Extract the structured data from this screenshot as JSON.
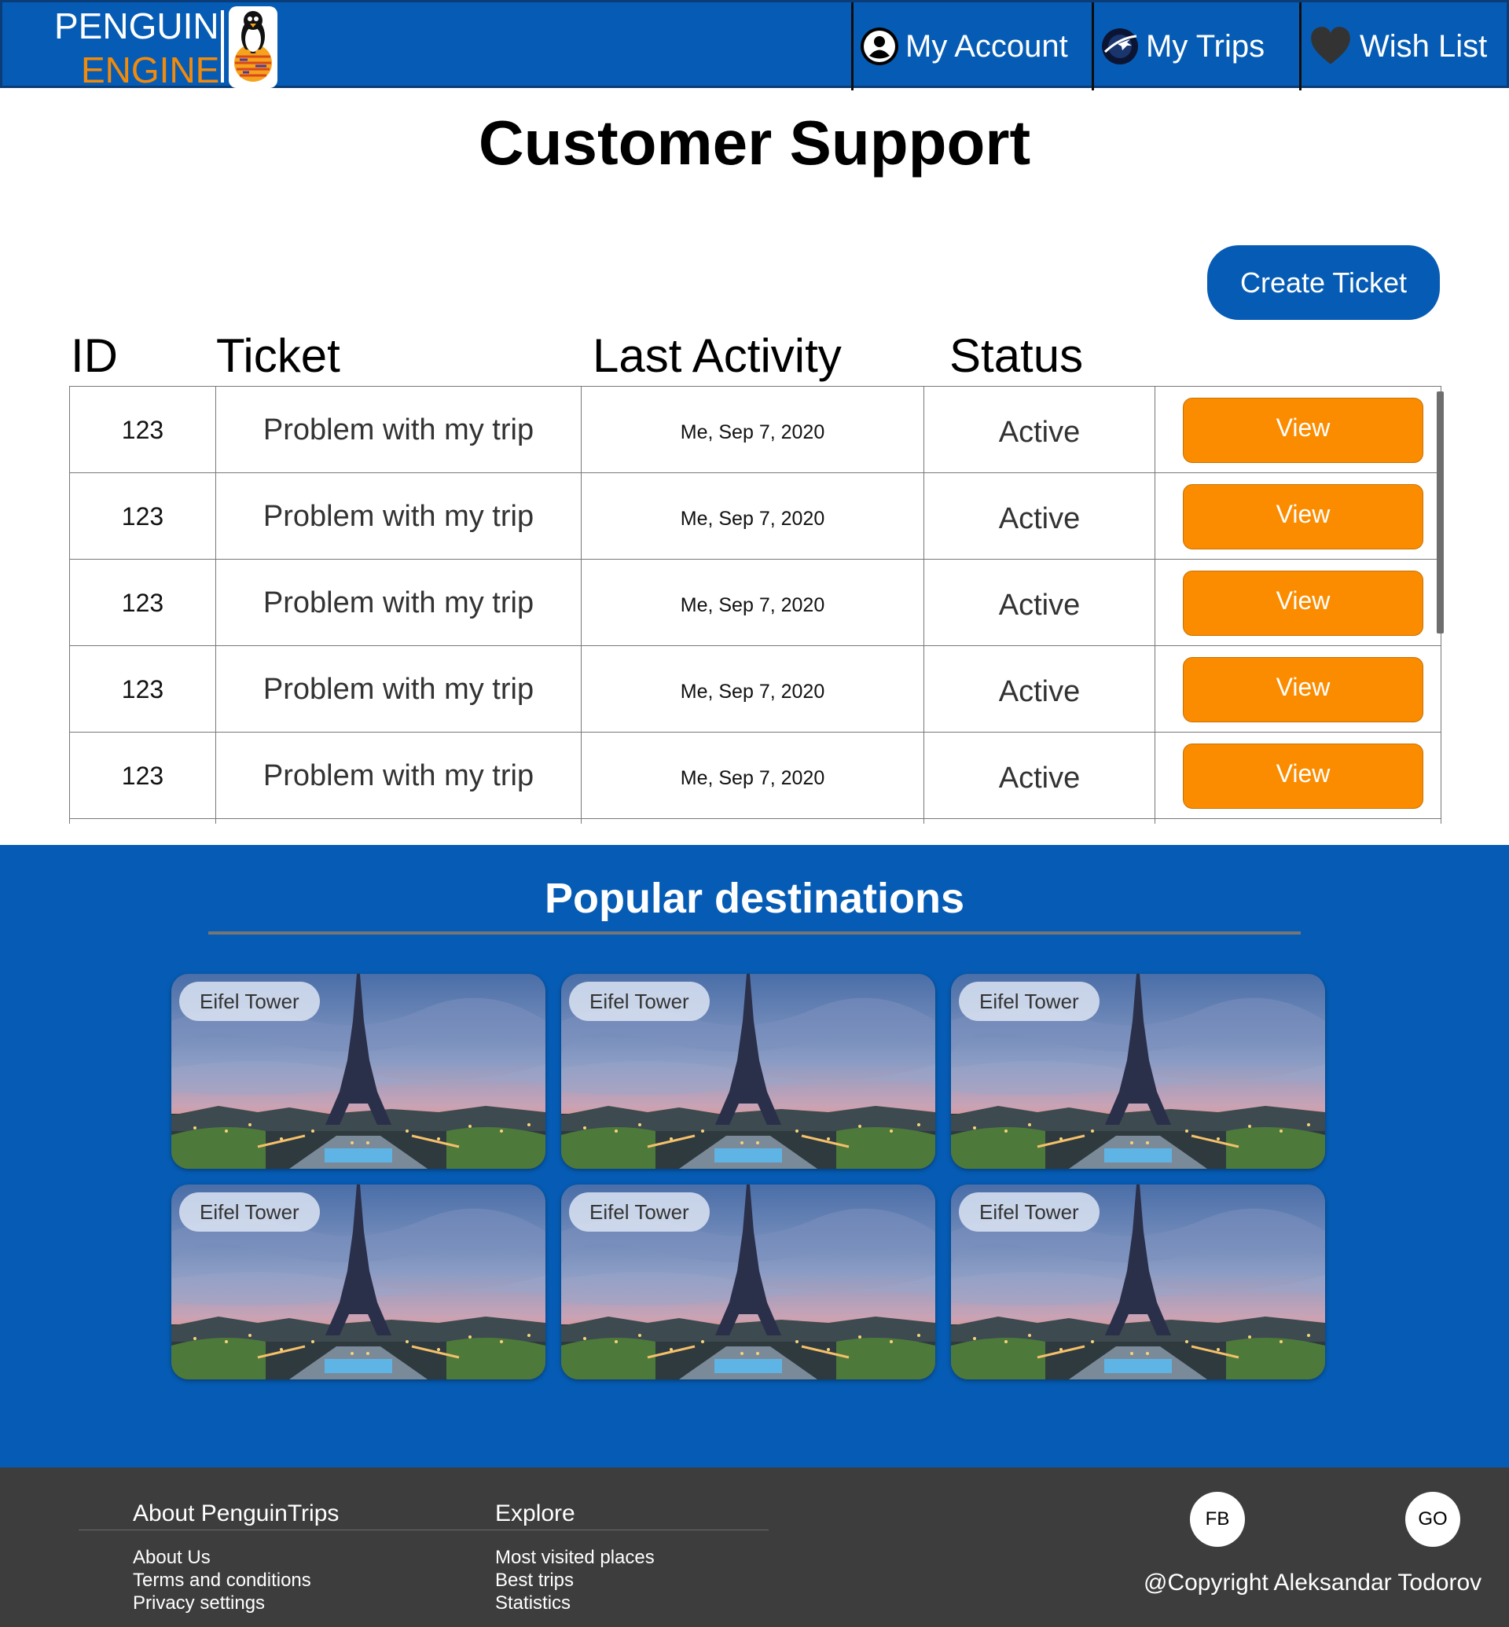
{
  "header": {
    "logo_line1": "PENGUIN",
    "logo_line2": "ENGINE",
    "nav": [
      {
        "label": "My Account",
        "icon": "user-icon"
      },
      {
        "label": "My Trips",
        "icon": "planet-plane-icon"
      },
      {
        "label": "Wish List",
        "icon": "heart-icon"
      }
    ]
  },
  "page": {
    "title": "Customer Support",
    "create_ticket_label": "Create Ticket"
  },
  "table": {
    "columns": [
      "ID",
      "Ticket",
      "Last Activity",
      "Status"
    ],
    "rows": [
      {
        "id": "123",
        "ticket": "Problem with my trip",
        "last_activity": "Me, Sep 7, 2020",
        "status": "Active",
        "action": "View"
      },
      {
        "id": "123",
        "ticket": "Problem with my trip",
        "last_activity": "Me, Sep 7, 2020",
        "status": "Active",
        "action": "View"
      },
      {
        "id": "123",
        "ticket": "Problem with my trip",
        "last_activity": "Me, Sep 7, 2020",
        "status": "Active",
        "action": "View"
      },
      {
        "id": "123",
        "ticket": "Problem with my trip",
        "last_activity": "Me, Sep 7, 2020",
        "status": "Active",
        "action": "View"
      },
      {
        "id": "123",
        "ticket": "Problem with my trip",
        "last_activity": "Me, Sep 7, 2020",
        "status": "Active",
        "action": "View"
      }
    ]
  },
  "destinations": {
    "title": "Popular destinations",
    "cards": [
      {
        "label": "Eifel Tower"
      },
      {
        "label": "Eifel Tower"
      },
      {
        "label": "Eifel Tower"
      },
      {
        "label": "Eifel Tower"
      },
      {
        "label": "Eifel Tower"
      },
      {
        "label": "Eifel Tower"
      }
    ]
  },
  "footer": {
    "about_heading": "About PenguinTrips",
    "about_links": [
      "About Us",
      "Terms and conditions",
      "Privacy settings"
    ],
    "explore_heading": "Explore",
    "explore_links": [
      "Most visited places",
      "Best trips",
      "Statistics"
    ],
    "social": [
      "FB",
      "GO"
    ],
    "copyright": "@Copyright Aleksandar Todorov"
  },
  "colors": {
    "brand_blue": "#065cb4",
    "accent_orange": "#fb8c00",
    "logo_orange": "#f28a0a",
    "footer_gray": "#3d3d3d"
  }
}
